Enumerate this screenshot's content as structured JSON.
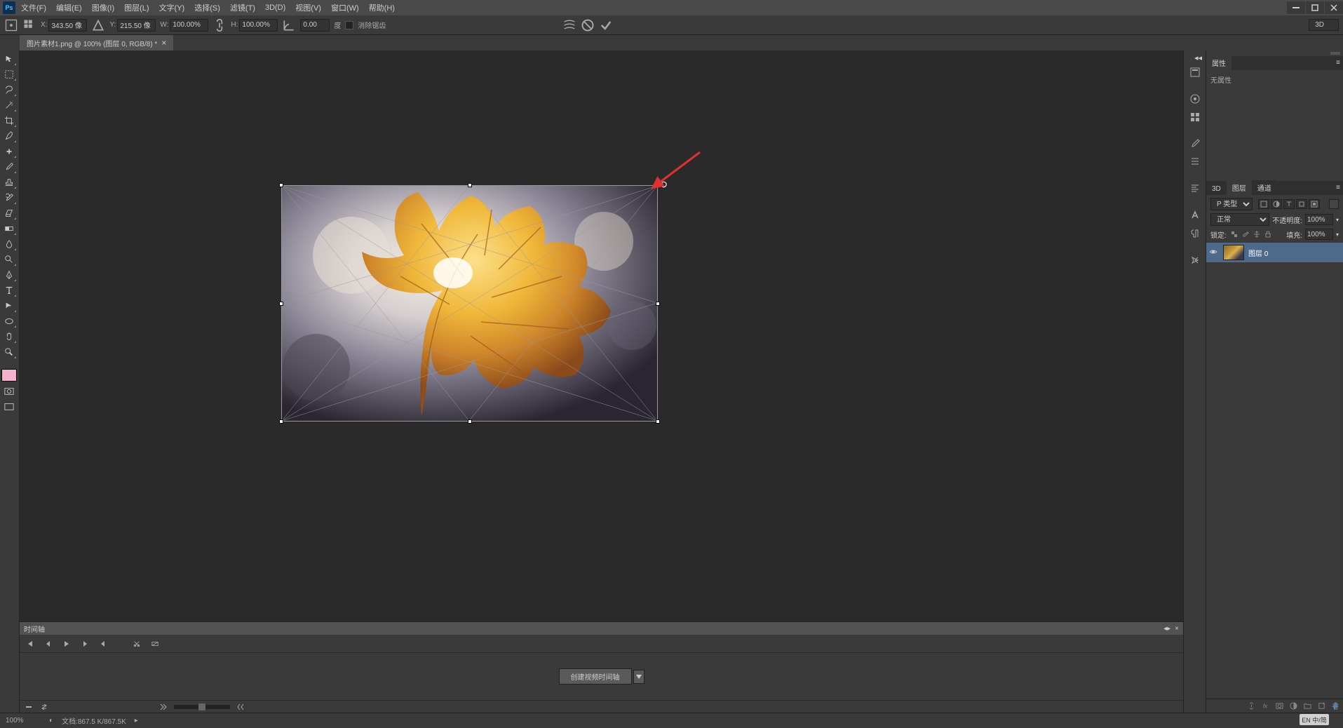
{
  "menu": {
    "items": [
      "文件(F)",
      "编辑(E)",
      "图像(I)",
      "图层(L)",
      "文字(Y)",
      "选择(S)",
      "滤镜(T)",
      "3D(D)",
      "视图(V)",
      "窗口(W)",
      "帮助(H)"
    ]
  },
  "options": {
    "x_label": "X:",
    "x_value": "343.50 像",
    "y_label": "Y:",
    "y_value": "215.50 像",
    "w_label": "W:",
    "w_value": "100.00%",
    "h_label": "H:",
    "h_value": "100.00%",
    "angle_value": "0.00",
    "angle_unit": "度",
    "antialias_label": "消除锯齿",
    "workspace": "3D"
  },
  "document": {
    "tab_title": "图片素材1.png @ 100% (图层 0, RGB/8) *"
  },
  "timeline": {
    "title": "时间轴",
    "create_button": "创建视频时间轴"
  },
  "properties": {
    "tab": "属性",
    "no_props": "无属性"
  },
  "layers": {
    "tabs": [
      "3D",
      "图层",
      "通道"
    ],
    "kind_label": "P 类型",
    "blend_mode": "正常",
    "opacity_label": "不透明度:",
    "opacity_value": "100%",
    "lock_label": "锁定:",
    "fill_label": "填充:",
    "fill_value": "100%",
    "layer_name": "图层 0"
  },
  "status": {
    "zoom": "100%",
    "doc_info": "文档:867.5 K/867.5K"
  },
  "ime": "EN 中/简"
}
